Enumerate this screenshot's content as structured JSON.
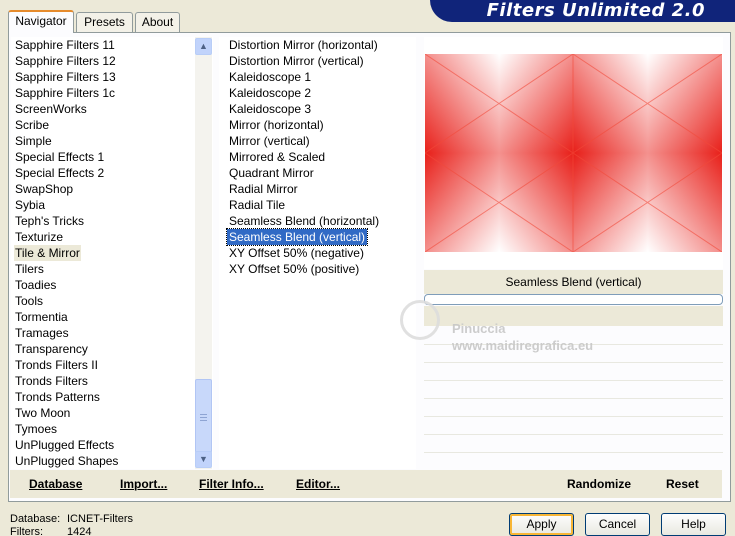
{
  "app": {
    "title": "Filters Unlimited 2.0"
  },
  "tabs": [
    {
      "label": "Navigator",
      "active": true
    },
    {
      "label": "Presets",
      "active": false
    },
    {
      "label": "About",
      "active": false
    }
  ],
  "categories": [
    "Sapphire Filters 11",
    "Sapphire Filters 12",
    "Sapphire Filters 13",
    "Sapphire Filters 1c",
    "ScreenWorks",
    "Scribe",
    "Simple",
    "Special Effects 1",
    "Special Effects 2",
    "SwapShop",
    "Sybia",
    "Teph's Tricks",
    "Texturize",
    "Tile & Mirror",
    "Tilers",
    "Toadies",
    "Tools",
    "Tormentia",
    "Tramages",
    "Transparency",
    "Tronds Filters II",
    "Tronds Filters",
    "Tronds Patterns",
    "Two Moon",
    "Tymoes",
    "UnPlugged Effects",
    "UnPlugged Shapes"
  ],
  "selected_category": "Tile & Mirror",
  "filters": [
    "Distortion Mirror (horizontal)",
    "Distortion Mirror (vertical)",
    "Kaleidoscope 1",
    "Kaleidoscope 2",
    "Kaleidoscope 3",
    "Mirror (horizontal)",
    "Mirror (vertical)",
    "Mirrored & Scaled",
    "Quadrant Mirror",
    "Radial Mirror",
    "Radial Tile",
    "Seamless Blend (horizontal)",
    "Seamless Blend (vertical)",
    "XY Offset 50% (negative)",
    "XY Offset 50% (positive)"
  ],
  "selected_filter": "Seamless Blend (vertical)",
  "preview": {
    "filter_name": "Seamless Blend (vertical)",
    "progress": 0
  },
  "watermark": {
    "line1": "Pinuccia",
    "line2": "www.maidiregrafica.eu"
  },
  "bottom_bar": {
    "database": "Database",
    "import": "Import...",
    "filter_info": "Filter Info...",
    "editor": "Editor...",
    "randomize": "Randomize",
    "reset": "Reset"
  },
  "status": {
    "database_label": "Database:",
    "database_value": "ICNET-Filters",
    "filters_label": "Filters:",
    "filters_value": "1424"
  },
  "buttons": {
    "apply": "Apply",
    "cancel": "Cancel",
    "help": "Help"
  },
  "colors": {
    "accent": "#10247a",
    "selection": "#316ac5",
    "preview_red": "#e8201a"
  },
  "icons": {
    "scroll_up": "chevron-up-icon",
    "scroll_down": "chevron-down-icon"
  }
}
